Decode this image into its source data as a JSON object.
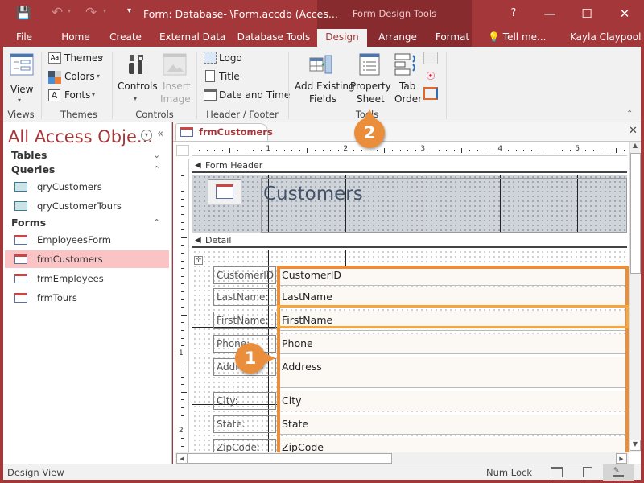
{
  "window": {
    "title": "Form: Database- \\Form.accdb (Acces...",
    "contextual_group": "Form Design Tools",
    "help": "?",
    "minimize": "—",
    "maximize": "☐",
    "close": "✕"
  },
  "qat": {
    "save_icon": "save-icon",
    "undo_icon": "undo-icon",
    "redo_icon": "redo-icon",
    "customize": "▾"
  },
  "tabs": [
    "File",
    "Home",
    "Create",
    "External Data",
    "Database Tools",
    "Design",
    "Arrange",
    "Format"
  ],
  "active_tab": "Design",
  "tell_me": "Tell me...",
  "user": "Kayla Claypool",
  "ribbon": {
    "views": {
      "view": "View",
      "group": "Views"
    },
    "themes": {
      "themes": "Themes",
      "colors": "Colors",
      "fonts": "Fonts",
      "group": "Themes"
    },
    "controls": {
      "controls": "Controls",
      "insert_image_1": "Insert",
      "insert_image_2": "Image",
      "group": "Controls"
    },
    "header_footer": {
      "logo": "Logo",
      "title": "Title",
      "date_time": "Date and Time",
      "group": "Header / Footer"
    },
    "tools": {
      "add_existing_1": "Add Existing",
      "add_existing_2": "Fields",
      "property_1": "Property",
      "property_2": "Sheet",
      "tab_order_1": "Tab",
      "tab_order_2": "Order",
      "group": "Tools"
    }
  },
  "nav": {
    "title": "All Access Obje...",
    "sections": [
      {
        "name": "Tables",
        "items": []
      },
      {
        "name": "Queries",
        "items": [
          "qryCustomers",
          "qryCustomerTours"
        ]
      },
      {
        "name": "Forms",
        "items": [
          "EmployeesForm",
          "frmCustomers",
          "frmEmployees",
          "frmTours"
        ]
      }
    ],
    "selected": "frmCustomers"
  },
  "document": {
    "tab": "frmCustomers",
    "ruler": [
      "1",
      "2",
      "3",
      "4",
      "5"
    ],
    "vruler": [
      "1",
      "2"
    ],
    "form_header_label": "Form Header",
    "detail_label": "Detail",
    "header_title": "Customers",
    "fields": [
      {
        "label": "CustomerID:",
        "control": "CustomerID"
      },
      {
        "label": "LastName:",
        "control": "LastName"
      },
      {
        "label": "FirstName:",
        "control": "FirstName"
      },
      {
        "label": "Phone:",
        "control": "Phone"
      },
      {
        "label": "Address:",
        "control": "Address"
      },
      {
        "label": "City:",
        "control": "City"
      },
      {
        "label": "State:",
        "control": "State"
      },
      {
        "label": "ZipCode:",
        "control": "ZipCode"
      }
    ]
  },
  "callouts": {
    "one": "1",
    "two": "2"
  },
  "status": {
    "left": "Design View",
    "num_lock": "Num Lock"
  },
  "colors": {
    "brand": "#a4373a",
    "callout": "#ea8e3b",
    "selection": "#fcc3c5"
  }
}
